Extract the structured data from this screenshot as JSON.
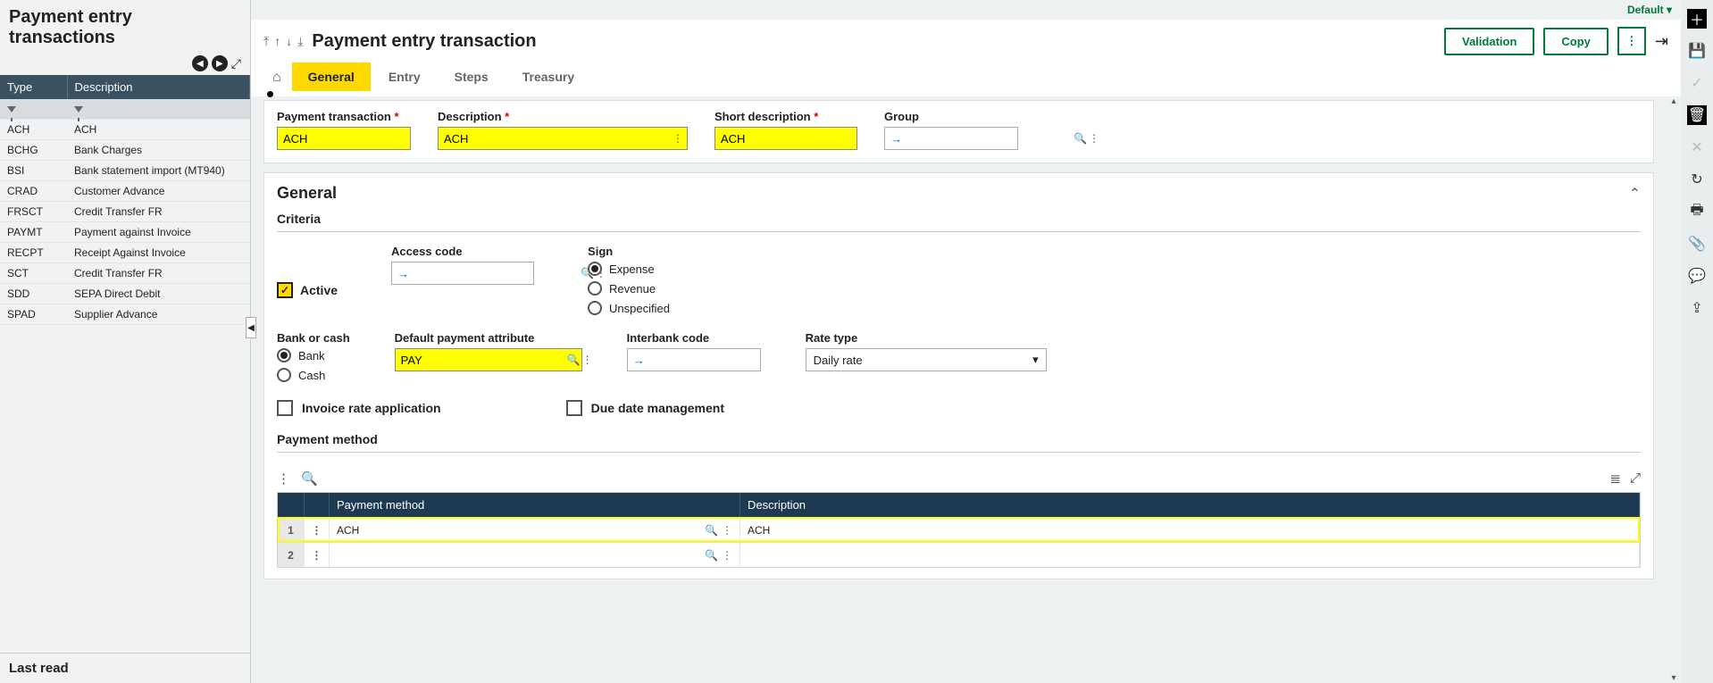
{
  "left": {
    "title": "Payment entry transactions",
    "columns": {
      "type": "Type",
      "description": "Description"
    },
    "rows": [
      {
        "type": "ACH",
        "desc": "ACH"
      },
      {
        "type": "BCHG",
        "desc": "Bank Charges"
      },
      {
        "type": "BSI",
        "desc": "Bank statement import (MT940)"
      },
      {
        "type": "CRAD",
        "desc": "Customer Advance"
      },
      {
        "type": "FRSCT",
        "desc": "Credit Transfer FR"
      },
      {
        "type": "PAYMT",
        "desc": "Payment against Invoice"
      },
      {
        "type": "RECPT",
        "desc": "Receipt Against Invoice"
      },
      {
        "type": "SCT",
        "desc": "Credit Transfer FR"
      },
      {
        "type": "SDD",
        "desc": "SEPA Direct Debit"
      },
      {
        "type": "SPAD",
        "desc": "Supplier Advance"
      }
    ],
    "last_read": "Last read"
  },
  "header": {
    "default_label": "Default",
    "title": "Payment entry transaction",
    "validation": "Validation",
    "copy": "Copy",
    "tabs": {
      "general": "General",
      "entry": "Entry",
      "steps": "Steps",
      "treasury": "Treasury"
    }
  },
  "fields": {
    "payment_transaction": {
      "label": "Payment transaction",
      "value": "ACH"
    },
    "description": {
      "label": "Description",
      "value": "ACH"
    },
    "short_description": {
      "label": "Short description",
      "value": "ACH"
    },
    "group": {
      "label": "Group",
      "value": ""
    }
  },
  "general": {
    "title": "General",
    "criteria_label": "Criteria",
    "active_label": "Active",
    "access_code_label": "Access code",
    "sign": {
      "label": "Sign",
      "expense": "Expense",
      "revenue": "Revenue",
      "unspecified": "Unspecified"
    },
    "bank_or_cash": {
      "label": "Bank or cash",
      "bank": "Bank",
      "cash": "Cash"
    },
    "default_payment_attr": {
      "label": "Default payment attribute",
      "value": "PAY"
    },
    "interbank_code": {
      "label": "Interbank code",
      "value": ""
    },
    "rate_type": {
      "label": "Rate type",
      "value": "Daily rate"
    },
    "invoice_rate": "Invoice rate application",
    "due_date": "Due date management",
    "payment_method_label": "Payment method",
    "pm_columns": {
      "pm": "Payment method",
      "desc": "Description"
    },
    "pm_rows": [
      {
        "n": "1",
        "pm": "ACH",
        "desc": "ACH"
      },
      {
        "n": "2",
        "pm": "",
        "desc": ""
      }
    ]
  }
}
